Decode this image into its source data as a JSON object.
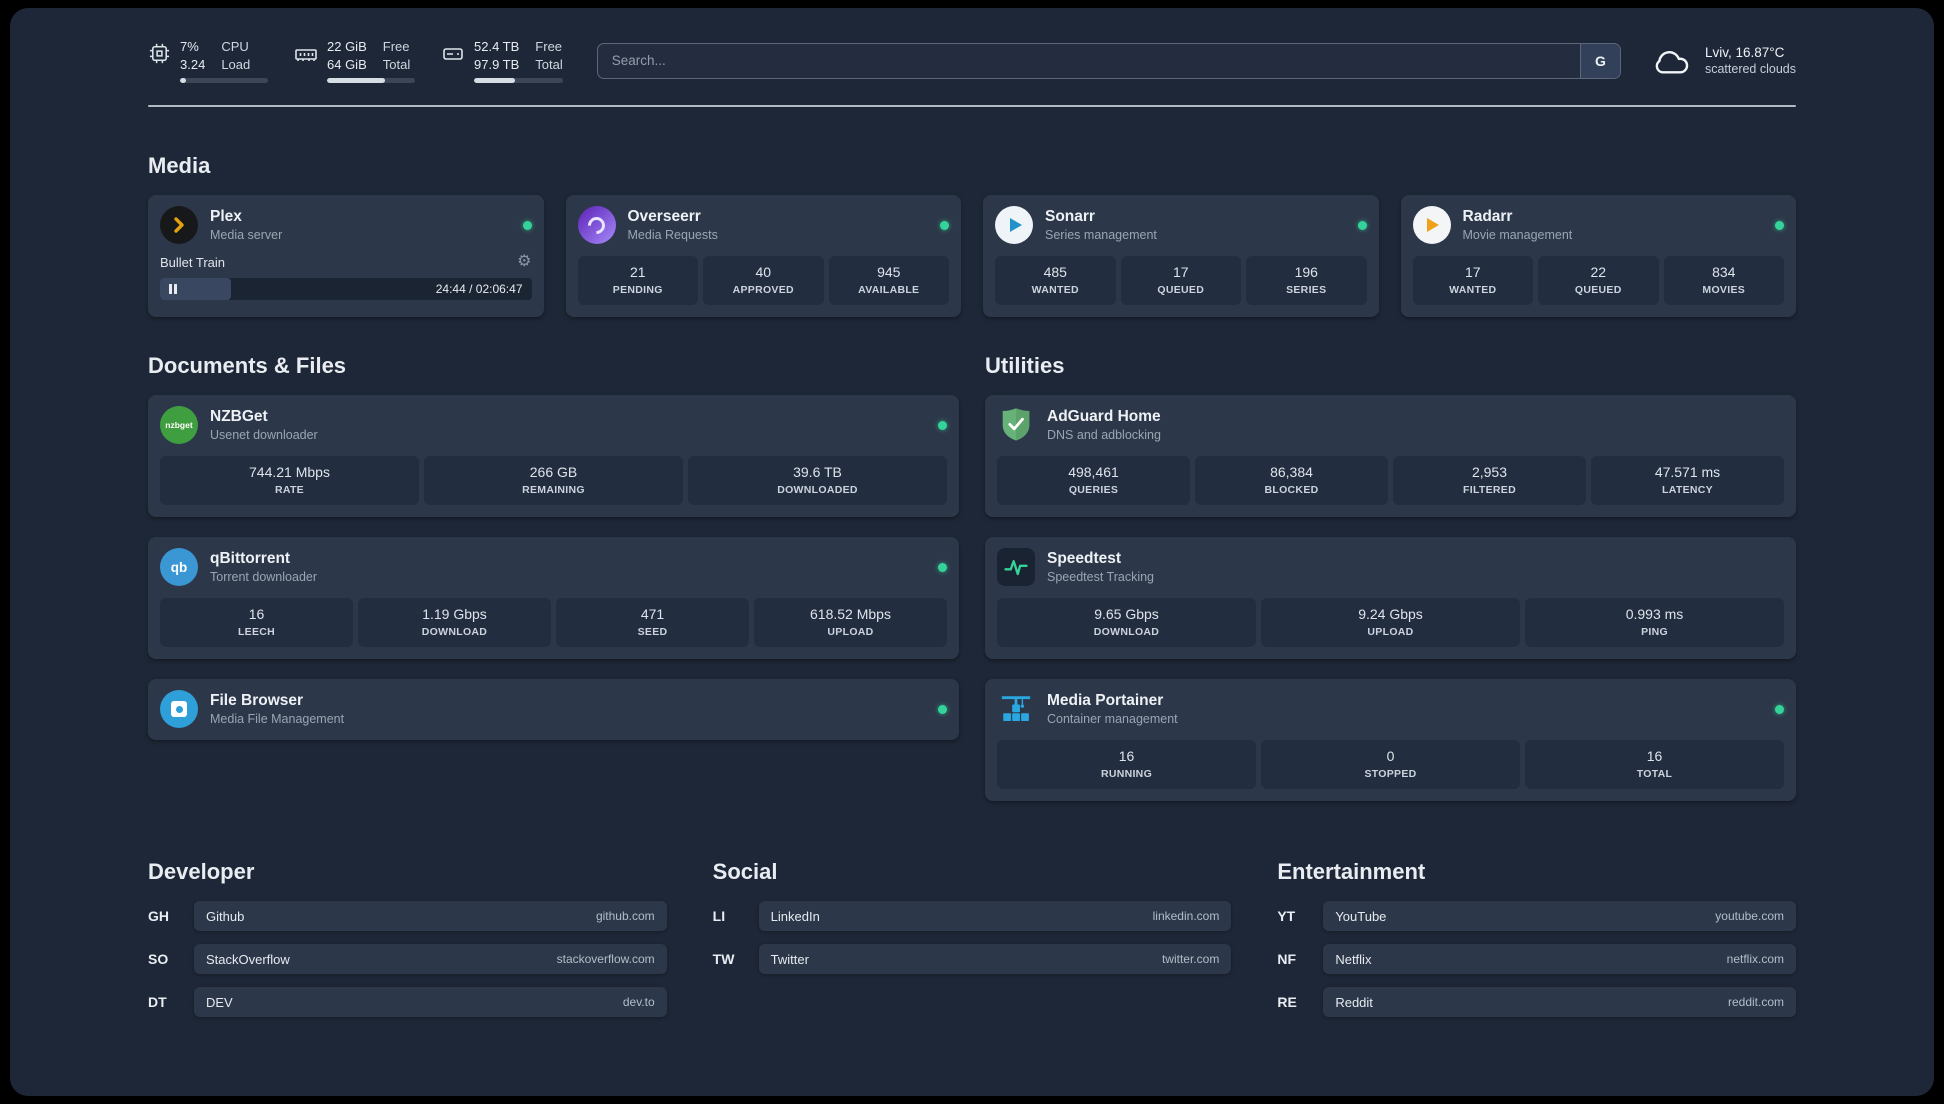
{
  "colors": {
    "status_online": "#34d399",
    "background": "#1e2737",
    "card": "#2c3849",
    "tile": "#222d40",
    "plex_accent": "#e5a00d",
    "overseerr_accent": "#8b5cf6",
    "sonarr_accent": "#2193c9",
    "radarr_accent": "#f0a11c",
    "nzbget_accent": "#3f9e3f",
    "qbittorrent_accent": "#3b97d3",
    "filebrowser_accent": "#2f9fd9",
    "adguard_accent": "#67b279",
    "speedtest_accent": "#34d399",
    "portainer_accent": "#2aa7e0"
  },
  "topbar": {
    "cpu": {
      "percent": "7%",
      "load": "3.24",
      "label_top": "CPU",
      "label_bottom": "Load",
      "bar_pct": 7
    },
    "ram": {
      "free_value": "22 GiB",
      "total_value": "64 GiB",
      "free_label": "Free",
      "total_label": "Total",
      "bar_pct": 66
    },
    "disk": {
      "free_value": "52.4 TB",
      "total_value": "97.9 TB",
      "free_label": "Free",
      "total_label": "Total",
      "bar_pct": 46
    },
    "search": {
      "placeholder": "Search...",
      "button": "G"
    },
    "weather": {
      "location": "Lviv, 16.87°C",
      "condition": "scattered clouds"
    }
  },
  "sections": {
    "media": "Media",
    "documents": "Documents & Files",
    "utilities": "Utilities",
    "developer": "Developer",
    "social": "Social",
    "entertainment": "Entertainment"
  },
  "services": {
    "plex": {
      "name": "Plex",
      "desc": "Media server",
      "player": {
        "title": "Bullet Train",
        "time": "24:44 / 02:06:47",
        "progress_pct": 19
      }
    },
    "overseerr": {
      "name": "Overseerr",
      "desc": "Media Requests",
      "stats": [
        {
          "value": "21",
          "label": "PENDING"
        },
        {
          "value": "40",
          "label": "APPROVED"
        },
        {
          "value": "945",
          "label": "AVAILABLE"
        }
      ]
    },
    "sonarr": {
      "name": "Sonarr",
      "desc": "Series management",
      "stats": [
        {
          "value": "485",
          "label": "WANTED"
        },
        {
          "value": "17",
          "label": "QUEUED"
        },
        {
          "value": "196",
          "label": "SERIES"
        }
      ]
    },
    "radarr": {
      "name": "Radarr",
      "desc": "Movie management",
      "stats": [
        {
          "value": "17",
          "label": "WANTED"
        },
        {
          "value": "22",
          "label": "QUEUED"
        },
        {
          "value": "834",
          "label": "MOVIES"
        }
      ]
    },
    "nzbget": {
      "name": "NZBGet",
      "desc": "Usenet downloader",
      "icon_text": "nzbget",
      "stats": [
        {
          "value": "744.21 Mbps",
          "label": "RATE"
        },
        {
          "value": "266 GB",
          "label": "REMAINING"
        },
        {
          "value": "39.6 TB",
          "label": "DOWNLOADED"
        }
      ]
    },
    "qbittorrent": {
      "name": "qBittorrent",
      "desc": "Torrent downloader",
      "icon_text": "qb",
      "stats": [
        {
          "value": "16",
          "label": "LEECH"
        },
        {
          "value": "1.19 Gbps",
          "label": "DOWNLOAD"
        },
        {
          "value": "471",
          "label": "SEED"
        },
        {
          "value": "618.52 Mbps",
          "label": "UPLOAD"
        }
      ]
    },
    "filebrowser": {
      "name": "File Browser",
      "desc": "Media File Management"
    },
    "adguard": {
      "name": "AdGuard Home",
      "desc": "DNS and adblocking",
      "stats": [
        {
          "value": "498,461",
          "label": "QUERIES"
        },
        {
          "value": "86,384",
          "label": "BLOCKED"
        },
        {
          "value": "2,953",
          "label": "FILTERED"
        },
        {
          "value": "47.571 ms",
          "label": "LATENCY"
        }
      ]
    },
    "speedtest": {
      "name": "Speedtest",
      "desc": "Speedtest Tracking",
      "stats": [
        {
          "value": "9.65 Gbps",
          "label": "DOWNLOAD"
        },
        {
          "value": "9.24 Gbps",
          "label": "UPLOAD"
        },
        {
          "value": "0.993 ms",
          "label": "PING"
        }
      ]
    },
    "portainer": {
      "name": "Media Portainer",
      "desc": "Container management",
      "stats": [
        {
          "value": "16",
          "label": "RUNNING"
        },
        {
          "value": "0",
          "label": "STOPPED"
        },
        {
          "value": "16",
          "label": "TOTAL"
        }
      ]
    }
  },
  "bookmarks": {
    "developer": [
      {
        "abbr": "GH",
        "name": "Github",
        "url": "github.com"
      },
      {
        "abbr": "SO",
        "name": "StackOverflow",
        "url": "stackoverflow.com"
      },
      {
        "abbr": "DT",
        "name": "DEV",
        "url": "dev.to"
      }
    ],
    "social": [
      {
        "abbr": "LI",
        "name": "LinkedIn",
        "url": "linkedin.com"
      },
      {
        "abbr": "TW",
        "name": "Twitter",
        "url": "twitter.com"
      }
    ],
    "entertainment": [
      {
        "abbr": "YT",
        "name": "YouTube",
        "url": "youtube.com"
      },
      {
        "abbr": "NF",
        "name": "Netflix",
        "url": "netflix.com"
      },
      {
        "abbr": "RE",
        "name": "Reddit",
        "url": "reddit.com"
      }
    ]
  }
}
